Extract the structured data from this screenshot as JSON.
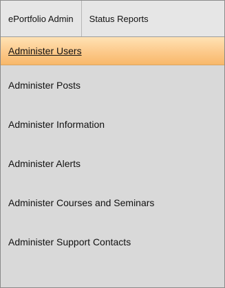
{
  "top_nav": {
    "tabs": [
      {
        "label": "ePortfolio Admin"
      },
      {
        "label": "Status Reports"
      }
    ]
  },
  "menu": {
    "items": [
      {
        "label": "Administer Users",
        "active": true
      },
      {
        "label": "Administer Posts"
      },
      {
        "label": "Administer Information"
      },
      {
        "label": "Administer Alerts"
      },
      {
        "label": "Administer Courses and Seminars"
      },
      {
        "label": "Administer Support Contacts"
      }
    ]
  },
  "colors": {
    "active_item_background": "#fcc98a",
    "panel_background": "#d9d9d9",
    "top_nav_background": "#e6e6e6"
  }
}
